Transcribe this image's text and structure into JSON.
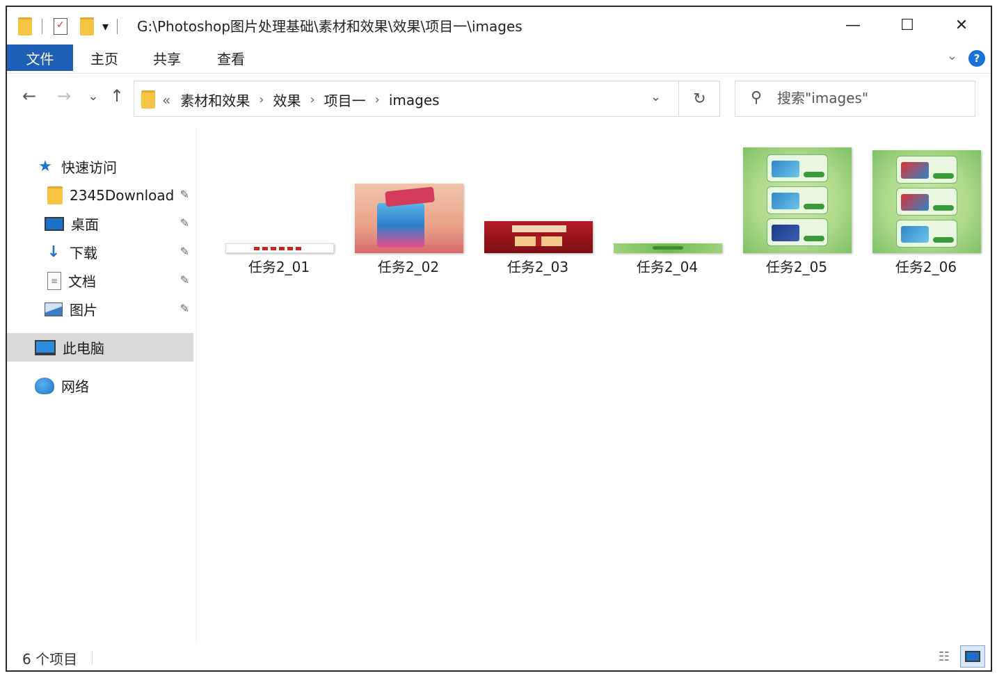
{
  "titlebar": {
    "path": "G:\\Photoshop图片处理基础\\素材和效果\\效果\\项目一\\images",
    "dropdown_glyph": "▾",
    "minimize": "—",
    "maximize": "☐",
    "close": "✕"
  },
  "ribbon": {
    "tabs": [
      "文件",
      "主页",
      "共享",
      "查看"
    ],
    "help": "?",
    "expand_glyph": "⌄",
    "accent": "#1f5fb5"
  },
  "nav": {
    "back": "←",
    "forward": "→",
    "recent": "⌄",
    "up": "↑",
    "overflow": "«",
    "breadcrumbs": [
      "素材和效果",
      "效果",
      "项目一",
      "images"
    ],
    "crumb_sep": "›",
    "address_dropdown": "⌄",
    "refresh": "↻",
    "search_placeholder": "搜索\"images\""
  },
  "sidebar": {
    "quick_access": "快速访问",
    "pinned": [
      {
        "label": "2345Download",
        "icon": "folder-icon"
      },
      {
        "label": "桌面",
        "icon": "desktop-icon"
      },
      {
        "label": "下载",
        "icon": "download-icon"
      },
      {
        "label": "文档",
        "icon": "document-icon"
      },
      {
        "label": "图片",
        "icon": "pictures-icon"
      }
    ],
    "pin_glyph": "📌",
    "this_pc": "此电脑",
    "network": "网络"
  },
  "files": [
    {
      "name": "任务2_01"
    },
    {
      "name": "任务2_02"
    },
    {
      "name": "任务2_03"
    },
    {
      "name": "任务2_04"
    },
    {
      "name": "任务2_05"
    },
    {
      "name": "任务2_06"
    }
  ],
  "status": {
    "count": "6 个项目"
  }
}
